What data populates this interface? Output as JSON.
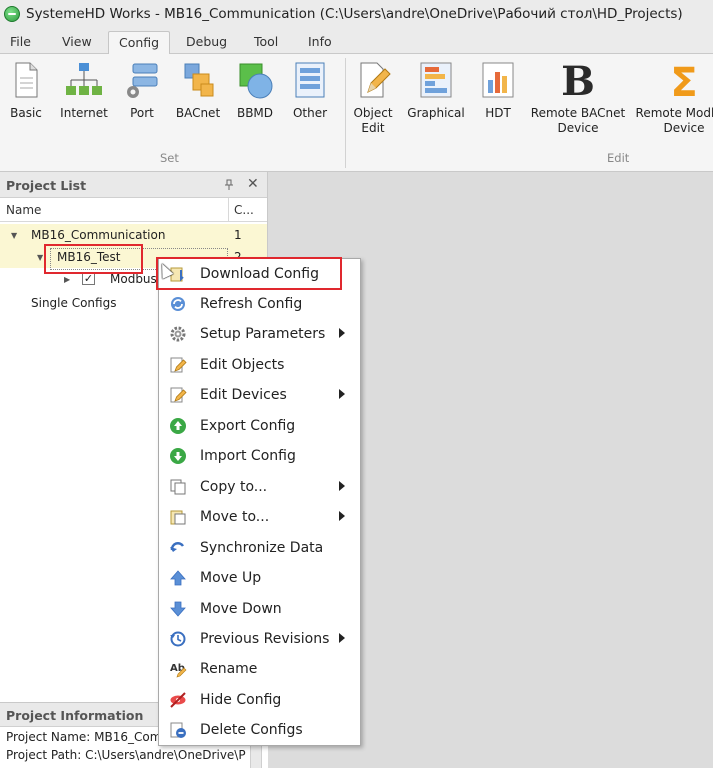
{
  "window": {
    "title": "SystemeHD Works - MB16_Communication (C:\\Users\\andre\\OneDrive\\Рабочий стол\\HD_Projects)"
  },
  "menu": {
    "tabs": [
      "File",
      "View",
      "Config",
      "Debug",
      "Tool",
      "Info"
    ],
    "active": "Config"
  },
  "ribbon": {
    "set_group": "Set",
    "edit_group": "Edit",
    "buttons": {
      "basic": "Basic",
      "internet": "Internet",
      "port": "Port",
      "bacnet": "BACnet",
      "bbmd": "BBMD",
      "other": "Other",
      "object_edit_1": "Object",
      "object_edit_2": "Edit",
      "graphical": "Graphical",
      "hdt": "HDT",
      "remote_bacnet_1": "Remote BACnet",
      "remote_bacnet_2": "Device",
      "remote_modbus_1": "Remote Modbus",
      "remote_modbus_2": "Device"
    }
  },
  "project_list": {
    "title": "Project List",
    "columns": {
      "name": "Name",
      "c": "C..."
    },
    "rows": [
      {
        "name": "MB16_Communication",
        "c": "1"
      },
      {
        "name": "MB16_Test",
        "c": "2"
      },
      {
        "name": "Modbus",
        "c": ""
      },
      {
        "name": "Single Configs",
        "c": ""
      }
    ]
  },
  "project_info": {
    "title": "Project Information",
    "name_line": "Project Name: MB16_Com",
    "path_line": "Project Path: C:\\Users\\andre\\OneDrive\\P"
  },
  "context_menu": {
    "items": [
      {
        "label": "Download Config",
        "icon": "download-config-icon"
      },
      {
        "label": "Refresh Config",
        "icon": "refresh-icon"
      },
      {
        "label": "Setup Parameters",
        "icon": "gear-icon"
      },
      {
        "label": "Edit Objects",
        "icon": "edit-icon"
      },
      {
        "label": "Edit Devices",
        "icon": "edit-icon"
      },
      {
        "label": "Export Config",
        "icon": "export-icon"
      },
      {
        "label": "Import Config",
        "icon": "import-icon"
      },
      {
        "label": "Copy to...",
        "icon": "copy-icon"
      },
      {
        "label": "Move to...",
        "icon": "move-icon"
      },
      {
        "label": "Synchronize Data",
        "icon": "sync-icon"
      },
      {
        "label": "Move Up",
        "icon": "arrow-up-icon"
      },
      {
        "label": "Move Down",
        "icon": "arrow-down-icon"
      },
      {
        "label": "Previous Revisions",
        "icon": "history-icon"
      },
      {
        "label": "Rename",
        "icon": "rename-icon"
      },
      {
        "label": "Hide Config",
        "icon": "hide-icon"
      },
      {
        "label": "Delete Configs",
        "icon": "delete-icon"
      }
    ]
  },
  "colors": {
    "highlight_row": "#fbf7d3",
    "annotation_red": "#e0282e",
    "accent_green": "#3aa845"
  }
}
